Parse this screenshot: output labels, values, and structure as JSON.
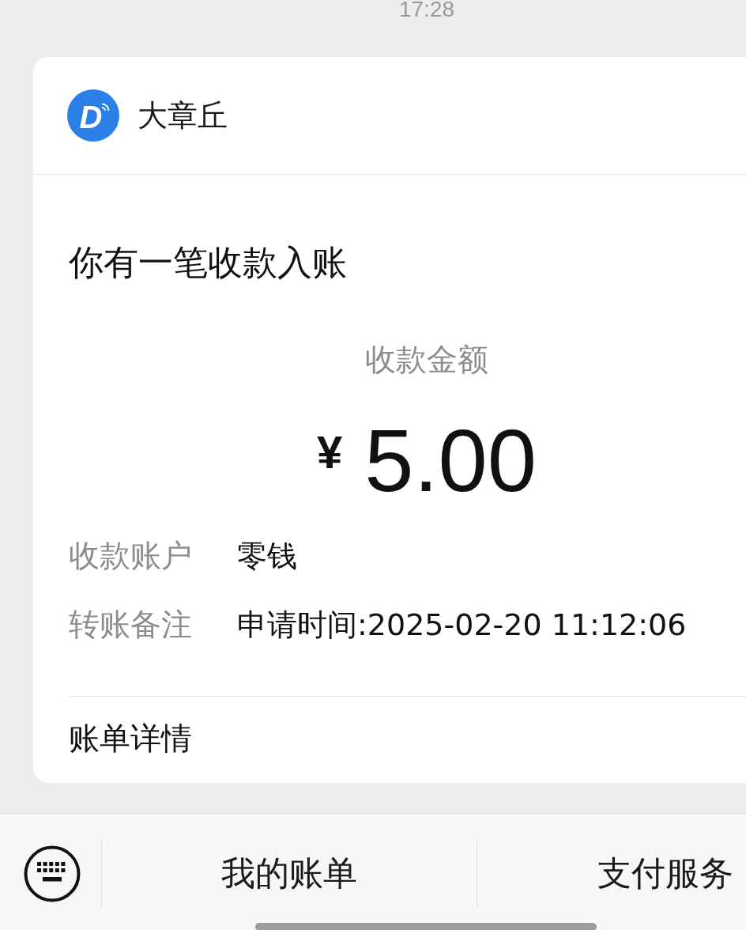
{
  "status_time": "17:28",
  "message_card": {
    "sender": {
      "logo_letter": "D",
      "name": "大章丘"
    },
    "title": "你有一笔收款入账",
    "amount_label": "收款金额",
    "currency": "¥",
    "amount": "5.00",
    "fields": [
      {
        "label": "收款账户",
        "value": "零钱"
      },
      {
        "label": "转账备注",
        "value": "申请时间:2025-02-20 11:12:06"
      }
    ],
    "footer_link": "账单详情"
  },
  "bottom_menu": {
    "items": [
      {
        "label": "我的账单"
      },
      {
        "label": "支付服务"
      }
    ]
  }
}
